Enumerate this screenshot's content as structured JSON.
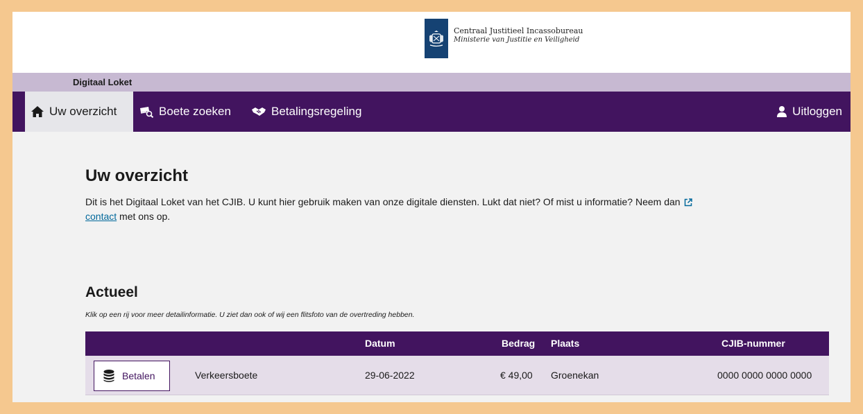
{
  "header": {
    "org_name": "Centraal Justitieel Incassobureau",
    "ministry": "Ministerie van Justitie en Veiligheid",
    "logo_icon": "coat-of-arms-icon"
  },
  "band": {
    "title": "Digitaal Loket"
  },
  "nav": {
    "items": [
      {
        "label": "Uw overzicht",
        "icon": "home-icon",
        "active": true
      },
      {
        "label": "Boete zoeken",
        "icon": "search-fine-icon",
        "active": false
      },
      {
        "label": "Betalingsregeling",
        "icon": "handshake-icon",
        "active": false
      }
    ],
    "logout": {
      "label": "Uitloggen",
      "icon": "user-icon"
    }
  },
  "main": {
    "title": "Uw overzicht",
    "intro_text": "Dit is het Digitaal Loket van het CJIB. U kunt hier gebruik maken van onze digitale diensten. Lukt dat niet? Of mist u informatie? Neem dan",
    "contact_link": "contact",
    "intro_tail": "met ons op."
  },
  "actueel": {
    "title": "Actueel",
    "hint": "Klik op een rij voor meer detailinformatie. U ziet dan ook of wij een flitsfoto van de overtreding hebben.",
    "columns": {
      "datum": "Datum",
      "bedrag": "Bedrag",
      "plaats": "Plaats",
      "cjib": "CJIB-nummer"
    },
    "rows": [
      {
        "action": "Betalen",
        "type": "Verkeersboete",
        "datum": "29-06-2022",
        "bedrag": "€ 49,00",
        "plaats": "Groenekan",
        "cjib": "0000 0000 0000 0000"
      }
    ]
  },
  "colors": {
    "brand_purple": "#42145f",
    "band_lilac": "#c7b9d2",
    "rijks_blue": "#154273",
    "link_blue": "#01689b",
    "outer_frame": "#f5c88f"
  }
}
